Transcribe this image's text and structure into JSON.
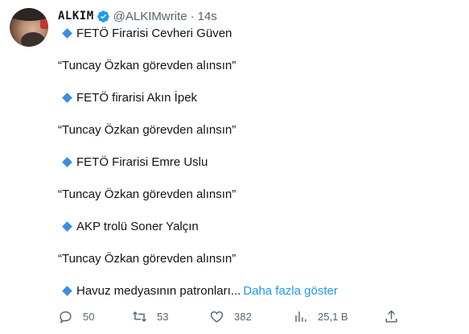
{
  "author": {
    "display_name": "ALKIM",
    "handle": "@ALKIMwrite",
    "separator": "·",
    "time": "14s"
  },
  "tweet": {
    "lines": [
      {
        "diamond": true,
        "text": "FETÖ Firarisi Cevheri Güven"
      },
      {
        "diamond": false,
        "text": "“Tuncay Özkan görevden alınsın”"
      },
      {
        "diamond": true,
        "text": "FETÖ firarisi Akın İpek"
      },
      {
        "diamond": false,
        "text": "“Tuncay Özkan görevden alınsın”"
      },
      {
        "diamond": true,
        "text": "FETÖ Firarisi Emre Uslu"
      },
      {
        "diamond": false,
        "text": "“Tuncay Özkan görevden alınsın”"
      },
      {
        "diamond": true,
        "text": "AKP trolü Soner Yalçın"
      },
      {
        "diamond": false,
        "text": "“Tuncay Özkan görevden alınsın”"
      },
      {
        "diamond": true,
        "text": "Havuz medyasının patronları..."
      }
    ],
    "show_more": "Daha fazla göster"
  },
  "actions": {
    "replies": "50",
    "retweets": "53",
    "likes": "382",
    "views": "25,1 B"
  },
  "icons": {
    "verified": "verified-badge-icon",
    "reply": "reply-icon",
    "retweet": "retweet-icon",
    "like": "heart-icon",
    "views": "views-icon",
    "share": "share-icon",
    "bullet": "blue-diamond-icon"
  },
  "colors": {
    "text": "#0f1419",
    "secondary": "#536471",
    "link": "#1d9bf0",
    "diamond": "#3d8de0",
    "verified": "#1d9bf0"
  }
}
